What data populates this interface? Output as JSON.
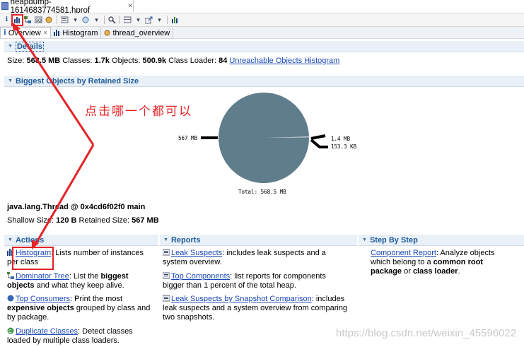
{
  "editor_tab": {
    "title": "heapdump-1614683774581.hprof",
    "close": "✕"
  },
  "subtabs": [
    {
      "label": "Overview",
      "icon": "info-icon"
    },
    {
      "label": "Histogram",
      "icon": "histogram-icon"
    },
    {
      "label": "thread_overview",
      "icon": "thread-icon"
    }
  ],
  "details": {
    "header": "Details",
    "size_label": "Size:",
    "size": "568.5 MB",
    "classes_label": "Classes:",
    "classes": "1.7k",
    "objects_label": "Objects:",
    "objects": "500.9k",
    "loader_label": "Class Loader:",
    "loader": "84",
    "link": "Unreachable Objects Histogram"
  },
  "biggest": {
    "header": "Biggest Objects by Retained Size",
    "total": "Total: 568.5 MB",
    "object_name": "java.lang.Thread @ 0x4cd6f02f0 main",
    "shallow_label": "Shallow Size:",
    "shallow": "120 B",
    "retained_label": "Retained Size:",
    "retained": "567 MB"
  },
  "chart_data": {
    "type": "pie",
    "slices": [
      {
        "label": "567 MB",
        "value": 567
      },
      {
        "label": "1.4 MB",
        "value": 1.4
      },
      {
        "label": "153.3 KB",
        "value": 0.15
      }
    ],
    "total_label": "Total: 568.5 MB",
    "colors": [
      "#607d8b",
      "#9fb2bd",
      "#ffffff"
    ]
  },
  "annotation": "点击哪一个都可以",
  "actions": {
    "header": "Actions",
    "histogram_link": "Histogram",
    "histogram_desc": ": Lists number of instances per class",
    "dominator_link": "Dominator Tree",
    "dominator_desc1": ": List the ",
    "dominator_bold": "biggest objects",
    "dominator_desc2": " and what they keep alive.",
    "consumers_link": "Top Consumers",
    "consumers_desc1": ": Print the most ",
    "consumers_bold": "expensive objects",
    "consumers_desc2": " grouped by class and by package.",
    "duplicate_link": "Duplicate Classes",
    "duplicate_desc": ": Detect classes loaded by multiple class loaders."
  },
  "reports": {
    "header": "Reports",
    "leak_link": "Leak Suspects",
    "leak_desc": ": includes leak suspects and a system overview.",
    "topcomp_link": "Top Components",
    "topcomp_desc": ": list reports for components bigger than 1 percent of the total heap.",
    "snap_link": "Leak Suspects by Snapshot Comparison",
    "snap_desc": ": includes leak suspects and a system overview from comparing two snapshots."
  },
  "step": {
    "header": "Step By Step",
    "comp_link": "Component Report",
    "comp_desc1": ": Analyze objects which belong to a ",
    "comp_bold1": "common root package",
    "comp_desc2": " or ",
    "comp_bold2": "class loader",
    "comp_desc3": "."
  },
  "watermark": "https://blog.csdn.net/weixin_45596022"
}
